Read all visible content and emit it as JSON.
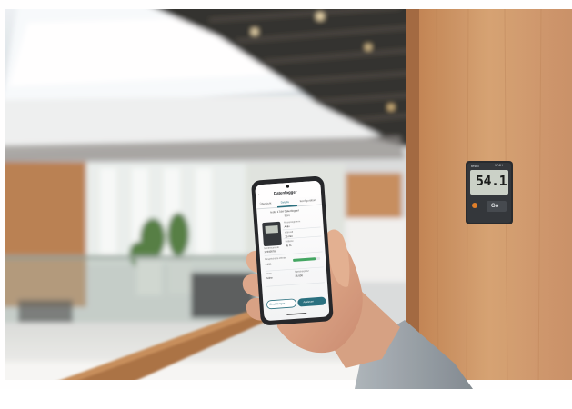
{
  "phone_app": {
    "header_title": "Datenlogger",
    "tabs": [
      "Übersicht",
      "Details",
      "Konfiguration"
    ],
    "device_line": "testo 174H Datenlogger",
    "device_subline": "Büro",
    "serial_label": "Seriennummer",
    "serial_value": "12345678",
    "fields": [
      {
        "label": "Messprogramm",
        "value": "Aktiv"
      },
      {
        "label": "Intervall",
        "value": "15 min"
      },
      {
        "label": "Batterie",
        "value": "85 %"
      },
      {
        "label": "Gespeicherte Werte",
        "value": "1.234"
      },
      {
        "label": "Speicherplatz",
        "value": "16.000"
      },
      {
        "label": "Alarm",
        "value": "Keine"
      }
    ],
    "buttons": [
      "Einstellungen",
      "Auslesen"
    ]
  },
  "logger": {
    "brand": "testo",
    "model": "174H",
    "display_value": "54.1",
    "button_label": "Go"
  },
  "colors": {
    "wood": "#c98a55",
    "wall": "#f4f2ef",
    "phone_accent": "#1f6a7a",
    "sleeve": "#9aa3aa",
    "railing": "#b57a46"
  }
}
